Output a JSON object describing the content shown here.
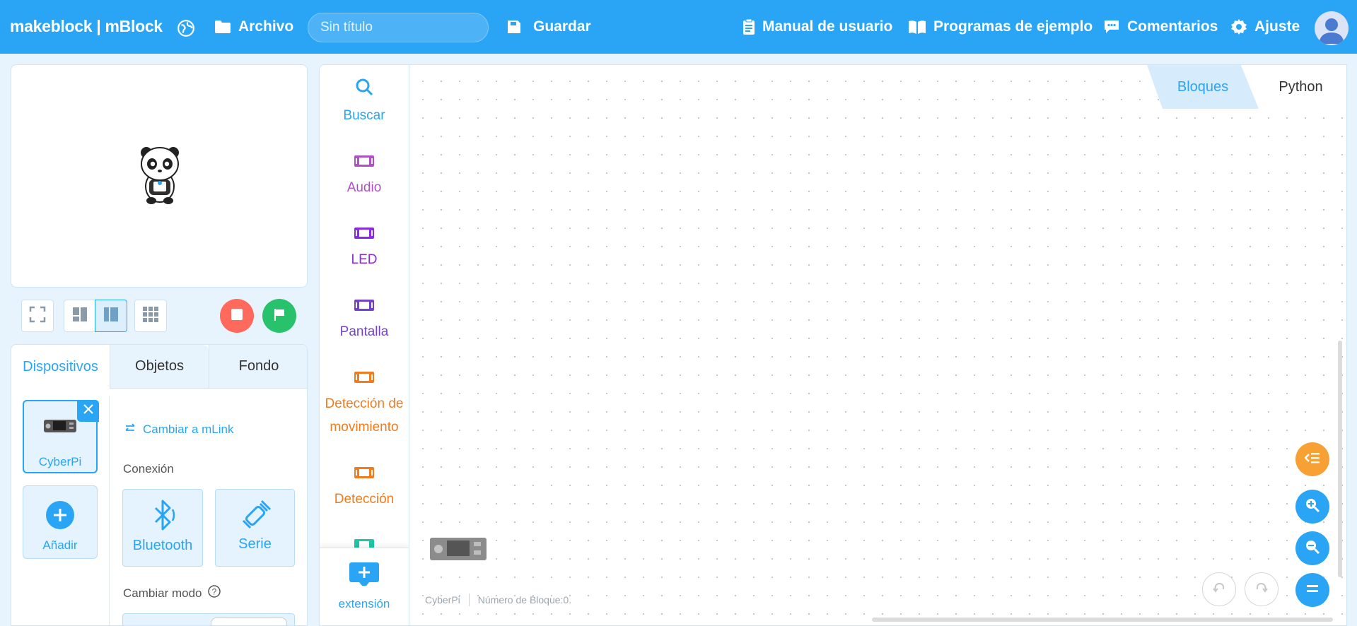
{
  "app": {
    "logo_text": "makeblock | mBlock"
  },
  "toolbar": {
    "file_label": "Archivo",
    "title_placeholder": "Sin título",
    "save_label": "Guardar",
    "manual_label": "Manual de usuario",
    "examples_label": "Programas de ejemplo",
    "feedback_label": "Comentarios",
    "settings_label": "Ajuste"
  },
  "device_panel": {
    "tabs": [
      "Dispositivos",
      "Objetos",
      "Fondo"
    ],
    "active_tab": "Dispositivos",
    "device_name": "CyberPi",
    "add_label": "Añadir",
    "switch_link_label": "Cambiar a mLink",
    "connection_label": "Conexión",
    "bluetooth_label": "Bluetooth",
    "serial_label": "Serie",
    "mode_label": "Cambiar modo"
  },
  "categories": [
    {
      "label": "Buscar",
      "color": "#2aa5f5",
      "icon": "search-icon"
    },
    {
      "label": "Audio",
      "color": "#b04fc8",
      "icon": "board-icon"
    },
    {
      "label": "LED",
      "color": "#8a2be2",
      "icon": "board-icon"
    },
    {
      "label": "Pantalla",
      "color": "#7442c8",
      "icon": "board-icon"
    },
    {
      "label": "Detección de movimiento",
      "color": "#f07c22",
      "icon": "board-icon"
    },
    {
      "label": "Detección",
      "color": "#f07c22",
      "icon": "board-icon"
    }
  ],
  "extension_label": "extensión",
  "code_tabs": {
    "blocks_label": "Bloques",
    "python_label": "Python"
  },
  "status": {
    "device": "CyberPi",
    "block_count": "Número de Bloque:0."
  },
  "colors": {
    "brand": "#2aa5f5",
    "stop": "#ff6a5c",
    "go": "#27c26b",
    "collapse": "#f7a134"
  }
}
